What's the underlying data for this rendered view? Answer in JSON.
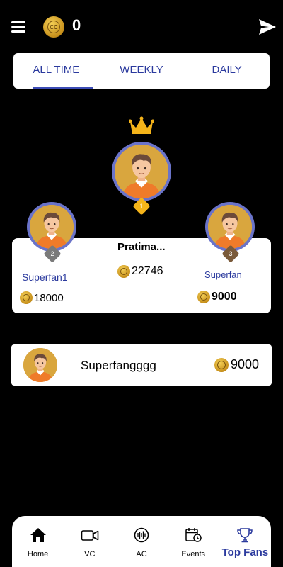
{
  "header": {
    "menu_icon": "hamburger-icon",
    "coin_icon": "coin-icon",
    "coin_label": "CC",
    "coin_count": "0",
    "send_icon": "send-icon"
  },
  "tabs": [
    {
      "label": "ALL TIME",
      "active": true
    },
    {
      "label": "WEEKLY",
      "active": false
    },
    {
      "label": "DAILY",
      "active": false
    }
  ],
  "podium": {
    "crown_icon": "crown-icon",
    "first": {
      "rank": "1",
      "name": "Pratima...",
      "score": "22746"
    },
    "second": {
      "rank": "2",
      "name": "Superfan1",
      "score": "18000"
    },
    "third": {
      "rank": "3",
      "name": "Superfan",
      "score": "9000"
    }
  },
  "list": [
    {
      "name": "Superfangggg",
      "score": "9000"
    }
  ],
  "nav": [
    {
      "label": "Home",
      "icon": "home-icon"
    },
    {
      "label": "VC",
      "icon": "video-camera-icon"
    },
    {
      "label": "AC",
      "icon": "audio-call-icon"
    },
    {
      "label": "Events",
      "icon": "calendar-clock-icon"
    },
    {
      "label": "Top Fans",
      "icon": "trophy-icon",
      "active": true
    }
  ],
  "colors": {
    "background": "#000000",
    "accent": "#2b3a9e",
    "avatar_ring": "#6a73c9",
    "gold": "#f5b41a",
    "silver": "#7a7a7a",
    "bronze": "#7a5a3a"
  }
}
